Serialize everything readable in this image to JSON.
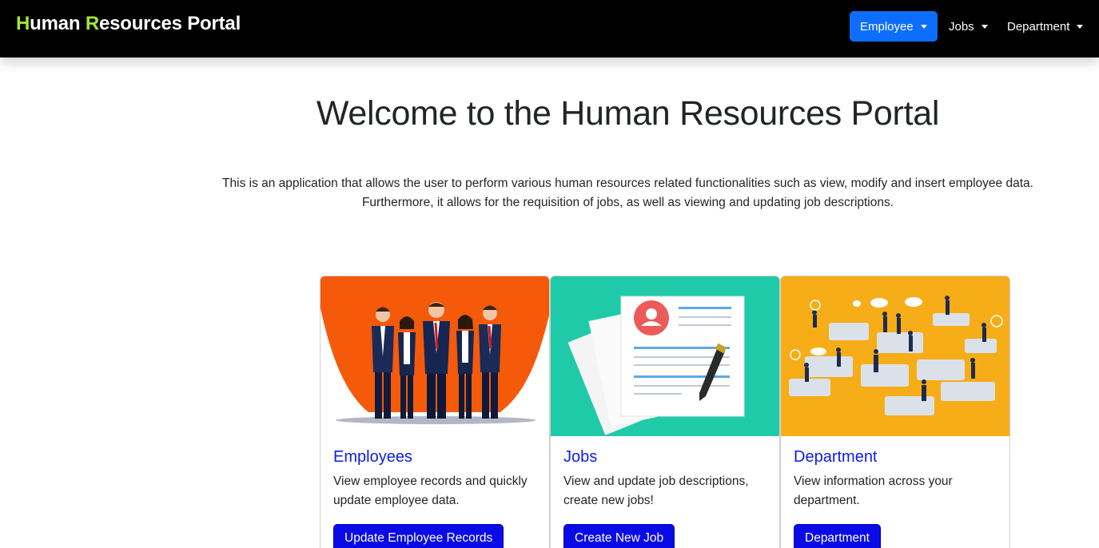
{
  "brand": {
    "first_letter": "H",
    "first_rest": "uman ",
    "second_letter": "R",
    "second_rest": "esources Portal"
  },
  "nav": [
    {
      "label": "Employee",
      "active": true
    },
    {
      "label": "Jobs"
    },
    {
      "label": "Department"
    }
  ],
  "hero": {
    "title": "Welcome to the Human Resources Portal",
    "line1": "This is an application that allows the user to perform various human resources related functionalities such as view, modify and insert employee data.",
    "line2": "Furthermore, it allows for the requisition of jobs, as well as viewing and updating job descriptions."
  },
  "cards": [
    {
      "title": "Employees",
      "text": "View employee records and quickly update employee data.",
      "button": "Update Employee Records",
      "image": "business-team-illustration"
    },
    {
      "title": "Jobs",
      "text": "View and update job descriptions, create new jobs!",
      "button": "Create New Job",
      "image": "resume-document-pen-illustration"
    },
    {
      "title": "Department",
      "text": "View information across your department.",
      "button": "Department",
      "image": "puzzle-teamwork-illustration"
    }
  ],
  "colors": {
    "navbar": "#000000",
    "brand_accent": "#a3e635",
    "active_nav": "#0d6efd",
    "link_blue": "#0a1ee8",
    "button_blue": "#0a0ae6"
  }
}
